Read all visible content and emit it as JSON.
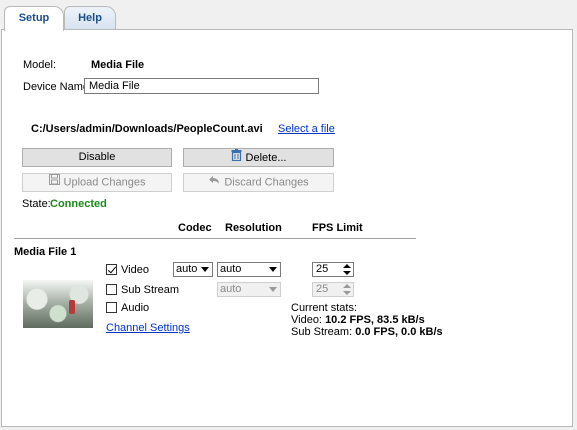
{
  "tabs": [
    {
      "label": "Setup"
    },
    {
      "label": "Help"
    }
  ],
  "device": {
    "model_label": "Model:",
    "model_value": "Media File",
    "name_label": "Device Name:",
    "name_value": "Media File"
  },
  "file": {
    "path": "C:/Users/admin/Downloads/PeopleCount.avi",
    "select_link": "Select a file"
  },
  "buttons": {
    "disable": "Disable",
    "delete": "Delete...",
    "upload": "Upload Changes",
    "discard": "Discard Changes"
  },
  "state": {
    "label": "State:",
    "value": "Connected",
    "color": "#1a8a1a"
  },
  "headers": {
    "codec": "Codec",
    "resolution": "Resolution",
    "fps": "FPS Limit"
  },
  "section_title": "Media File 1",
  "streams": {
    "video": {
      "label": "Video",
      "checked": true,
      "codec": "auto",
      "resolution": "auto",
      "fps": "25"
    },
    "sub": {
      "label": "Sub Stream",
      "checked": false,
      "resolution": "auto",
      "fps": "25"
    },
    "audio": {
      "label": "Audio",
      "checked": false
    }
  },
  "channel_settings_link": "Channel Settings",
  "stats": {
    "title": "Current stats:",
    "video_label": "Video:",
    "video_value": "10.2 FPS, 83.5 kB/s",
    "sub_label": "Sub Stream:",
    "sub_value": "0.0 FPS, 0.0 kB/s"
  },
  "icons": {
    "delete": "trash-icon",
    "upload": "floppy-disk-icon",
    "discard": "undo-arrow-icon"
  }
}
